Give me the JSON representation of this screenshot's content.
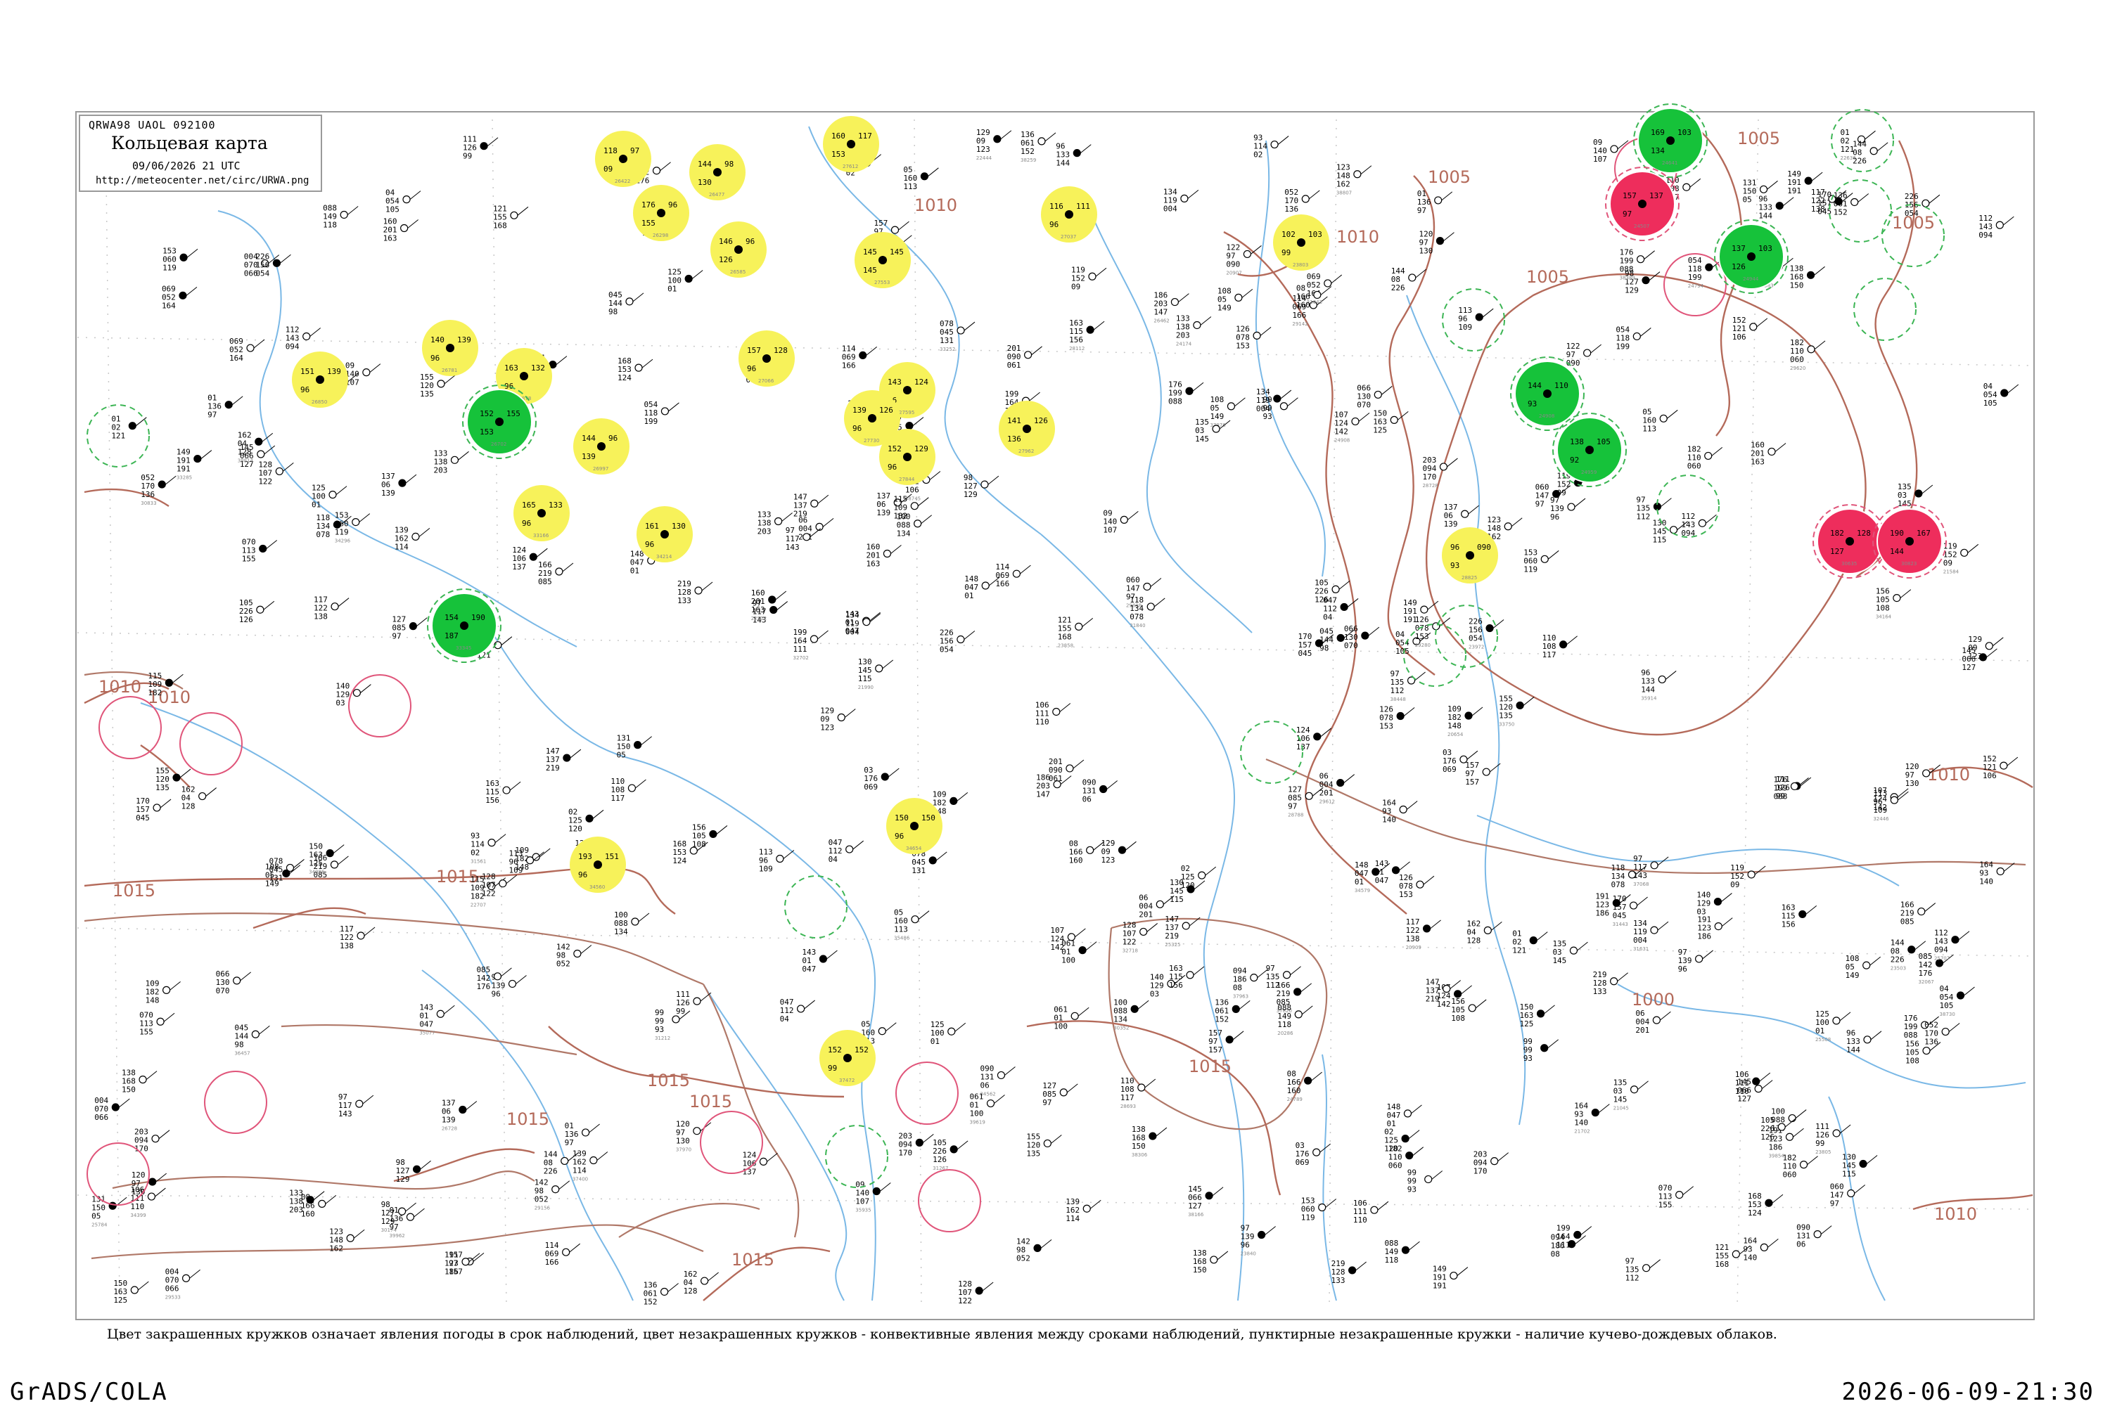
{
  "header": {
    "code": "QRWA98  UAOL  092100",
    "title": "Кольцевая карта",
    "time": "09/06/2026 21 UTC",
    "url": "http://meteocenter.net/circ/URWA.png"
  },
  "legend_note": "Цвет закрашенных кружков означает явления погоды в срок наблюдений, цвет незакрашенных кружков - конвективные явления между сроками наблюдений, пунктирные незакрашенные кружки - наличие кучево-дождевых облаков.",
  "footer": {
    "left": "GrADS/COLA",
    "right": "2026-06-09-21:30"
  },
  "colors": {
    "isobar": "#b46a5a",
    "river": "#7ab8e6",
    "border": "#b07868",
    "grid": "#c8c8c8",
    "fill_yellow": "#f7f25a",
    "fill_green": "#16c23a",
    "fill_red": "#ee2d5c",
    "ring_red": "#e0557a",
    "ring_green": "#3cb554"
  },
  "isobars": [
    {
      "label": "1005"
    },
    {
      "label": "1005"
    },
    {
      "label": "1005"
    },
    {
      "label": "1005"
    },
    {
      "label": "1000"
    },
    {
      "label": "1010"
    },
    {
      "label": "1010"
    },
    {
      "label": "1010"
    },
    {
      "label": "1010"
    },
    {
      "label": "1010"
    },
    {
      "label": "1010"
    },
    {
      "label": "1015"
    },
    {
      "label": "1015"
    },
    {
      "label": "1015"
    },
    {
      "label": "1015"
    },
    {
      "label": "1015"
    },
    {
      "label": "1015"
    },
    {
      "label": "1015"
    }
  ],
  "stations": [
    {
      "id": "26422",
      "values": [
        "118",
        "97",
        "09"
      ],
      "weather": "yellow"
    },
    {
      "id": "26477",
      "values": [
        "144",
        "98",
        "130"
      ],
      "weather": "yellow"
    },
    {
      "id": "26298",
      "values": [
        "176",
        "96",
        "155"
      ],
      "weather": "yellow"
    },
    {
      "id": "26585",
      "values": [
        "146",
        "96",
        "126"
      ],
      "weather": "yellow"
    },
    {
      "id": "27612",
      "values": [
        "160",
        "117",
        "153"
      ],
      "weather": "yellow"
    },
    {
      "id": "27553",
      "values": [
        "145",
        "145",
        "145"
      ],
      "weather": "yellow"
    },
    {
      "id": "26850",
      "values": [
        "151",
        "139",
        "96"
      ],
      "weather": "yellow"
    },
    {
      "id": "26781",
      "values": [
        "140",
        "139",
        "96"
      ],
      "weather": "yellow"
    },
    {
      "id": "26878",
      "values": [
        "163",
        "132",
        "96"
      ],
      "weather": "yellow"
    },
    {
      "id": "26997",
      "values": [
        "144",
        "96",
        "139"
      ],
      "weather": "yellow"
    },
    {
      "id": "27066",
      "values": [
        "157",
        "128",
        "96"
      ],
      "weather": "yellow"
    },
    {
      "id": "27595",
      "values": [
        "143",
        "124",
        "96"
      ],
      "weather": "yellow"
    },
    {
      "id": "27730",
      "values": [
        "139",
        "126",
        "96"
      ],
      "weather": "yellow"
    },
    {
      "id": "27844",
      "values": [
        "152",
        "129",
        "96"
      ],
      "weather": "yellow"
    },
    {
      "id": "27962",
      "values": [
        "141",
        "126",
        "136"
      ],
      "weather": "yellow"
    },
    {
      "id": "33166",
      "values": [
        "165",
        "133",
        "96"
      ],
      "weather": "yellow"
    },
    {
      "id": "34214",
      "values": [
        "161",
        "130",
        "96"
      ],
      "weather": "yellow"
    },
    {
      "id": "34654",
      "values": [
        "150",
        "150",
        "96"
      ],
      "weather": "yellow"
    },
    {
      "id": "34560",
      "values": [
        "193",
        "151",
        "96"
      ],
      "weather": "yellow"
    },
    {
      "id": "27037",
      "values": [
        "116",
        "111",
        "96"
      ],
      "weather": "yellow"
    },
    {
      "id": "23803",
      "values": [
        "102",
        "103",
        "99"
      ],
      "weather": "yellow"
    },
    {
      "id": "28825",
      "values": [
        "96",
        "090",
        "93"
      ],
      "weather": "yellow"
    },
    {
      "id": "37472",
      "values": [
        "152",
        "152",
        "99"
      ],
      "weather": "yellow"
    },
    {
      "id": "26702",
      "values": [
        "152",
        "155",
        "153"
      ],
      "weather": "green"
    },
    {
      "id": "33345",
      "values": [
        "154",
        "190",
        "187"
      ],
      "weather": "green"
    },
    {
      "id": "24908",
      "values": [
        "144",
        "110",
        "93"
      ],
      "weather": "green"
    },
    {
      "id": "24959",
      "values": [
        "138",
        "105",
        "92"
      ],
      "weather": "green"
    },
    {
      "id": "24641",
      "values": [
        "169",
        "103",
        "134"
      ],
      "weather": "green"
    },
    {
      "id": "24944",
      "values": [
        "137",
        "103",
        "126"
      ],
      "weather": "green"
    },
    {
      "id": "24507",
      "values": [
        "157",
        "137",
        "97"
      ],
      "weather": "red"
    },
    {
      "id": "30635",
      "values": [
        "182",
        "128",
        "127"
      ],
      "weather": "red"
    },
    {
      "id": "30823",
      "values": [
        "190",
        "167",
        "144"
      ],
      "weather": "red"
    }
  ],
  "scatter_numbers": [
    "131",
    "97",
    "09",
    "150",
    "128",
    "05",
    "143",
    "01",
    "97",
    "98",
    "139",
    "126",
    "145",
    "06",
    "112",
    "137",
    "152",
    "140",
    "96",
    "110",
    "121",
    "170",
    "97",
    "106",
    "163",
    "148",
    "100",
    "129",
    "142",
    "119",
    "124",
    "107",
    "156",
    "02",
    "133",
    "118",
    "03",
    "105",
    "160",
    "04",
    "114",
    "108",
    "130",
    "182",
    "125",
    "01",
    "93",
    "99",
    "155",
    "144",
    "166",
    "138",
    "136",
    "153",
    "120",
    "157",
    "147",
    "122",
    "134",
    "135",
    "109",
    "08",
    "117",
    "149",
    "191",
    "176",
    "127",
    "203",
    "219",
    "111",
    "113",
    "123",
    "226",
    "162",
    "164",
    "168",
    "115",
    "186",
    "199",
    "201",
    "078",
    "090",
    "061",
    "047",
    "052",
    "085",
    "054",
    "066",
    "045",
    "060",
    "088",
    "070",
    "094",
    "069",
    "004"
  ],
  "ui": {
    "title_box_alt": "Кольцевая карта"
  }
}
